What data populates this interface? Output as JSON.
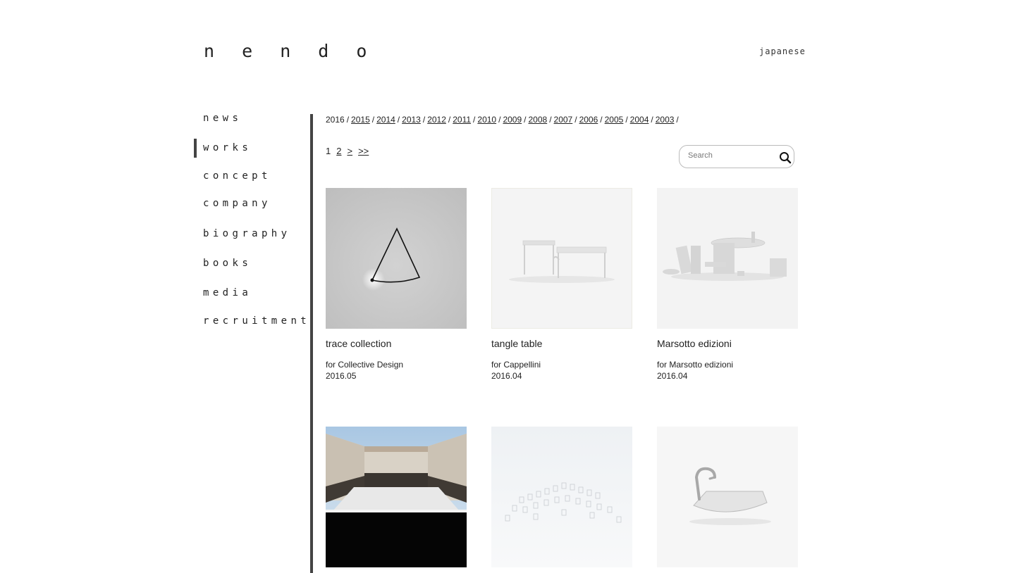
{
  "header": {
    "logo": "n e n d o",
    "language_link": "japanese"
  },
  "nav": {
    "items": [
      {
        "label": "news"
      },
      {
        "label": "works",
        "active": true
      },
      {
        "label": "concept"
      },
      {
        "label": "company"
      },
      {
        "label": "biography"
      },
      {
        "label": "books"
      },
      {
        "label": "media"
      },
      {
        "label": "recruitment"
      }
    ]
  },
  "years": {
    "current": "2016",
    "links": [
      "2015",
      "2014",
      "2013",
      "2012",
      "2011",
      "2010",
      "2009",
      "2008",
      "2007",
      "2006",
      "2005",
      "2004",
      "2003"
    ],
    "separator": "/"
  },
  "pager": {
    "current": "1",
    "page_2": "2",
    "next": ">",
    "last": ">>"
  },
  "search": {
    "placeholder": "Search"
  },
  "works": [
    {
      "title": "trace collection",
      "client": "for Collective Design",
      "date": "2016.05"
    },
    {
      "title": "tangle table",
      "client": "for Cappellini",
      "date": "2016.04"
    },
    {
      "title": "Marsotto edizioni",
      "client": "for Marsotto edizioni",
      "date": "2016.04"
    },
    {
      "title": "",
      "client": "",
      "date": ""
    },
    {
      "title": "",
      "client": "",
      "date": ""
    },
    {
      "title": "",
      "client": "",
      "date": ""
    }
  ],
  "colors": {
    "accent_bar": "#444444",
    "text": "#222222"
  }
}
